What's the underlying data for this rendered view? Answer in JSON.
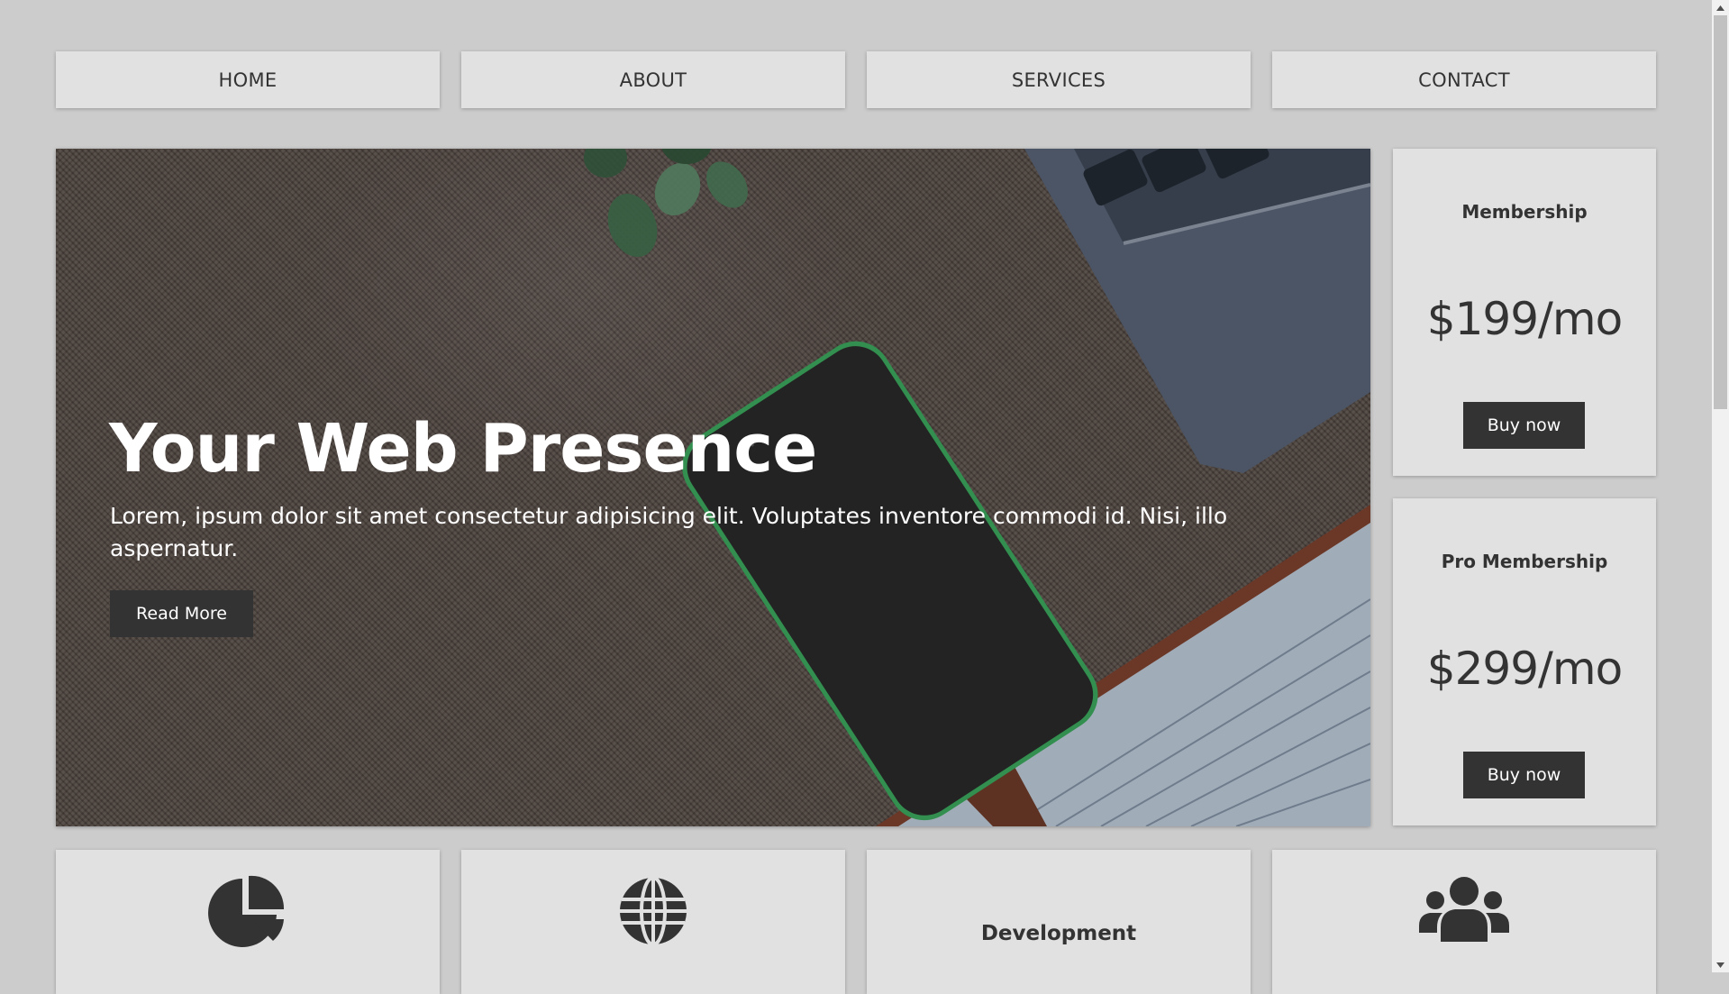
{
  "nav": {
    "items": [
      {
        "label": "HOME"
      },
      {
        "label": "ABOUT"
      },
      {
        "label": "SERVICES"
      },
      {
        "label": "CONTACT"
      }
    ]
  },
  "hero": {
    "title": "Your Web Presence",
    "text": "Lorem, ipsum dolor sit amet consectetur adipisicing elit. Voluptates inventore commodi id. Nisi, illo aspernatur.",
    "button_label": "Read More"
  },
  "pricing": [
    {
      "title": "Membership",
      "price": "$199/mo",
      "button_label": "Buy now"
    },
    {
      "title": "Pro Membership",
      "price": "$299/mo",
      "button_label": "Buy now"
    }
  ],
  "features": [
    {
      "icon": "pie-chart-icon",
      "title": ""
    },
    {
      "icon": "globe-icon",
      "title": ""
    },
    {
      "icon": "",
      "title": "Development"
    },
    {
      "icon": "users-icon",
      "title": ""
    }
  ],
  "colors": {
    "page_background": "#cccccc",
    "card_background": "#e1e1e1",
    "button_background": "#333333",
    "text": "#333333"
  }
}
